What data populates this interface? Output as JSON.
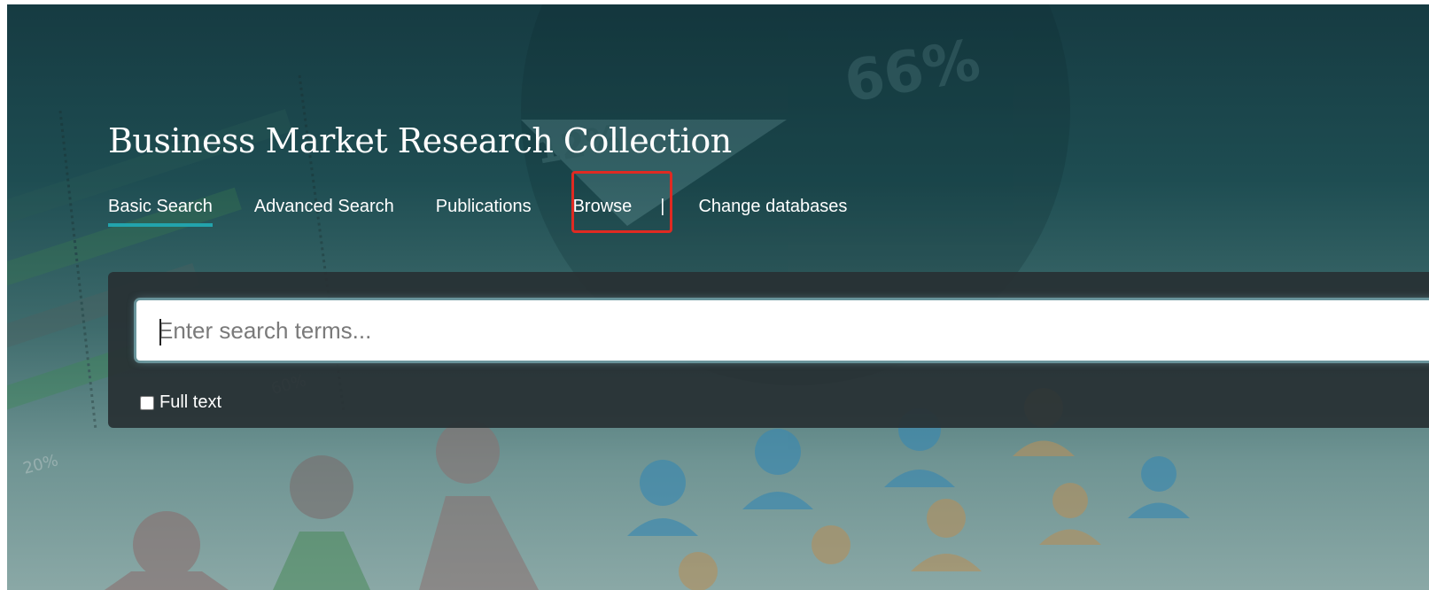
{
  "header": {
    "title": "Business Market Research Collection"
  },
  "nav": {
    "items": [
      {
        "label": "Basic Search",
        "active": true
      },
      {
        "label": "Advanced Search",
        "active": false
      },
      {
        "label": "Publications",
        "active": false
      },
      {
        "label": "Browse",
        "active": false
      },
      {
        "label": "Change databases",
        "active": false
      }
    ],
    "separator": "|"
  },
  "search": {
    "placeholder": "Enter search terms...",
    "value": "",
    "fulltext_label": "Full text",
    "fulltext_checked": false
  },
  "colors": {
    "active_tab_underline": "#22a3ac",
    "annotation_box": "#e02a22",
    "panel_background": "#283034"
  }
}
